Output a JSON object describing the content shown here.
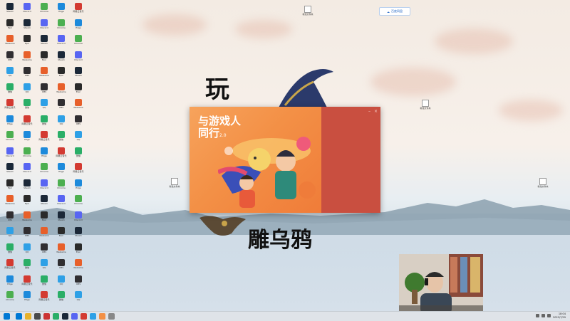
{
  "wallpaper": {
    "painted_text_top": "玩",
    "painted_text_bottom": "雕乌鸦"
  },
  "cloud_button": {
    "label": "百度网盘",
    "icon": "cloud-icon"
  },
  "splash": {
    "title_line1": "与游戏人",
    "title_line2": "同行",
    "title_suffix": "2.0",
    "minimize": "–",
    "close": "×"
  },
  "desktop_icons": [
    {
      "label": "Steam",
      "color": "#1b2838"
    },
    {
      "label": "Epic",
      "color": "#2a2a2a"
    },
    {
      "label": "WeGame",
      "color": "#e75f2a"
    },
    {
      "label": "OBS",
      "color": "#302e31"
    },
    {
      "label": "QQ",
      "color": "#2ea0e6"
    },
    {
      "label": "微信",
      "color": "#2aae67"
    },
    {
      "label": "网易云音乐",
      "color": "#d33a31"
    },
    {
      "label": "Edge",
      "color": "#1d8adb"
    },
    {
      "label": "Chrome",
      "color": "#4caf50"
    },
    {
      "label": "Discord",
      "color": "#5865f2"
    }
  ],
  "scattered_icons": [
    {
      "label": "新建文件夹"
    },
    {
      "label": "新建文件夹"
    },
    {
      "label": "新建文件夹"
    },
    {
      "label": "新建文件夹"
    }
  ],
  "taskbar": {
    "clock_time": "18:04",
    "clock_date": "2022/7/29",
    "colors": [
      "#0078d4",
      "#e7b12a",
      "#4a4a4a",
      "#cc3333",
      "#2aae67",
      "#1b2838",
      "#5865f2",
      "#d33a31",
      "#2ea0e6",
      "#f39046",
      "#888888"
    ]
  }
}
